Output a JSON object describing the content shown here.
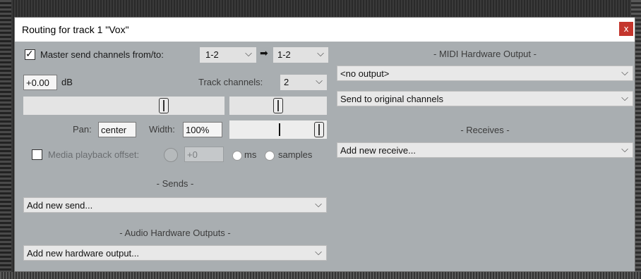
{
  "window": {
    "title": "Routing for track 1 \"Vox\"",
    "close_label": "x"
  },
  "master_send": {
    "checked": true,
    "label": "Master send channels from/to:",
    "from_value": "1-2",
    "to_value": "1-2",
    "arrow_icon": "right-arrow-icon"
  },
  "volume": {
    "value": "+0.00",
    "unit": "dB"
  },
  "track_channels": {
    "label": "Track channels:",
    "value": "2"
  },
  "pan": {
    "label": "Pan:",
    "value": "center",
    "width_label": "Width:",
    "width_value": "100%"
  },
  "media_offset": {
    "checked": false,
    "label": "Media playback offset:",
    "value": "+0",
    "unit_ms": "ms",
    "unit_samples": "samples"
  },
  "sends": {
    "header": "- Sends -",
    "dropdown": "Add new send..."
  },
  "audio_hw": {
    "header": "- Audio Hardware Outputs -",
    "dropdown": "Add new hardware output..."
  },
  "midi_hw": {
    "header": "- MIDI Hardware Output -",
    "output": "<no output>",
    "channels": "Send to original channels"
  },
  "receives": {
    "header": "- Receives -",
    "dropdown": "Add new receive..."
  },
  "icons": {
    "chevron": "chevron-down-icon",
    "check": "✓",
    "arrow": "➡"
  }
}
